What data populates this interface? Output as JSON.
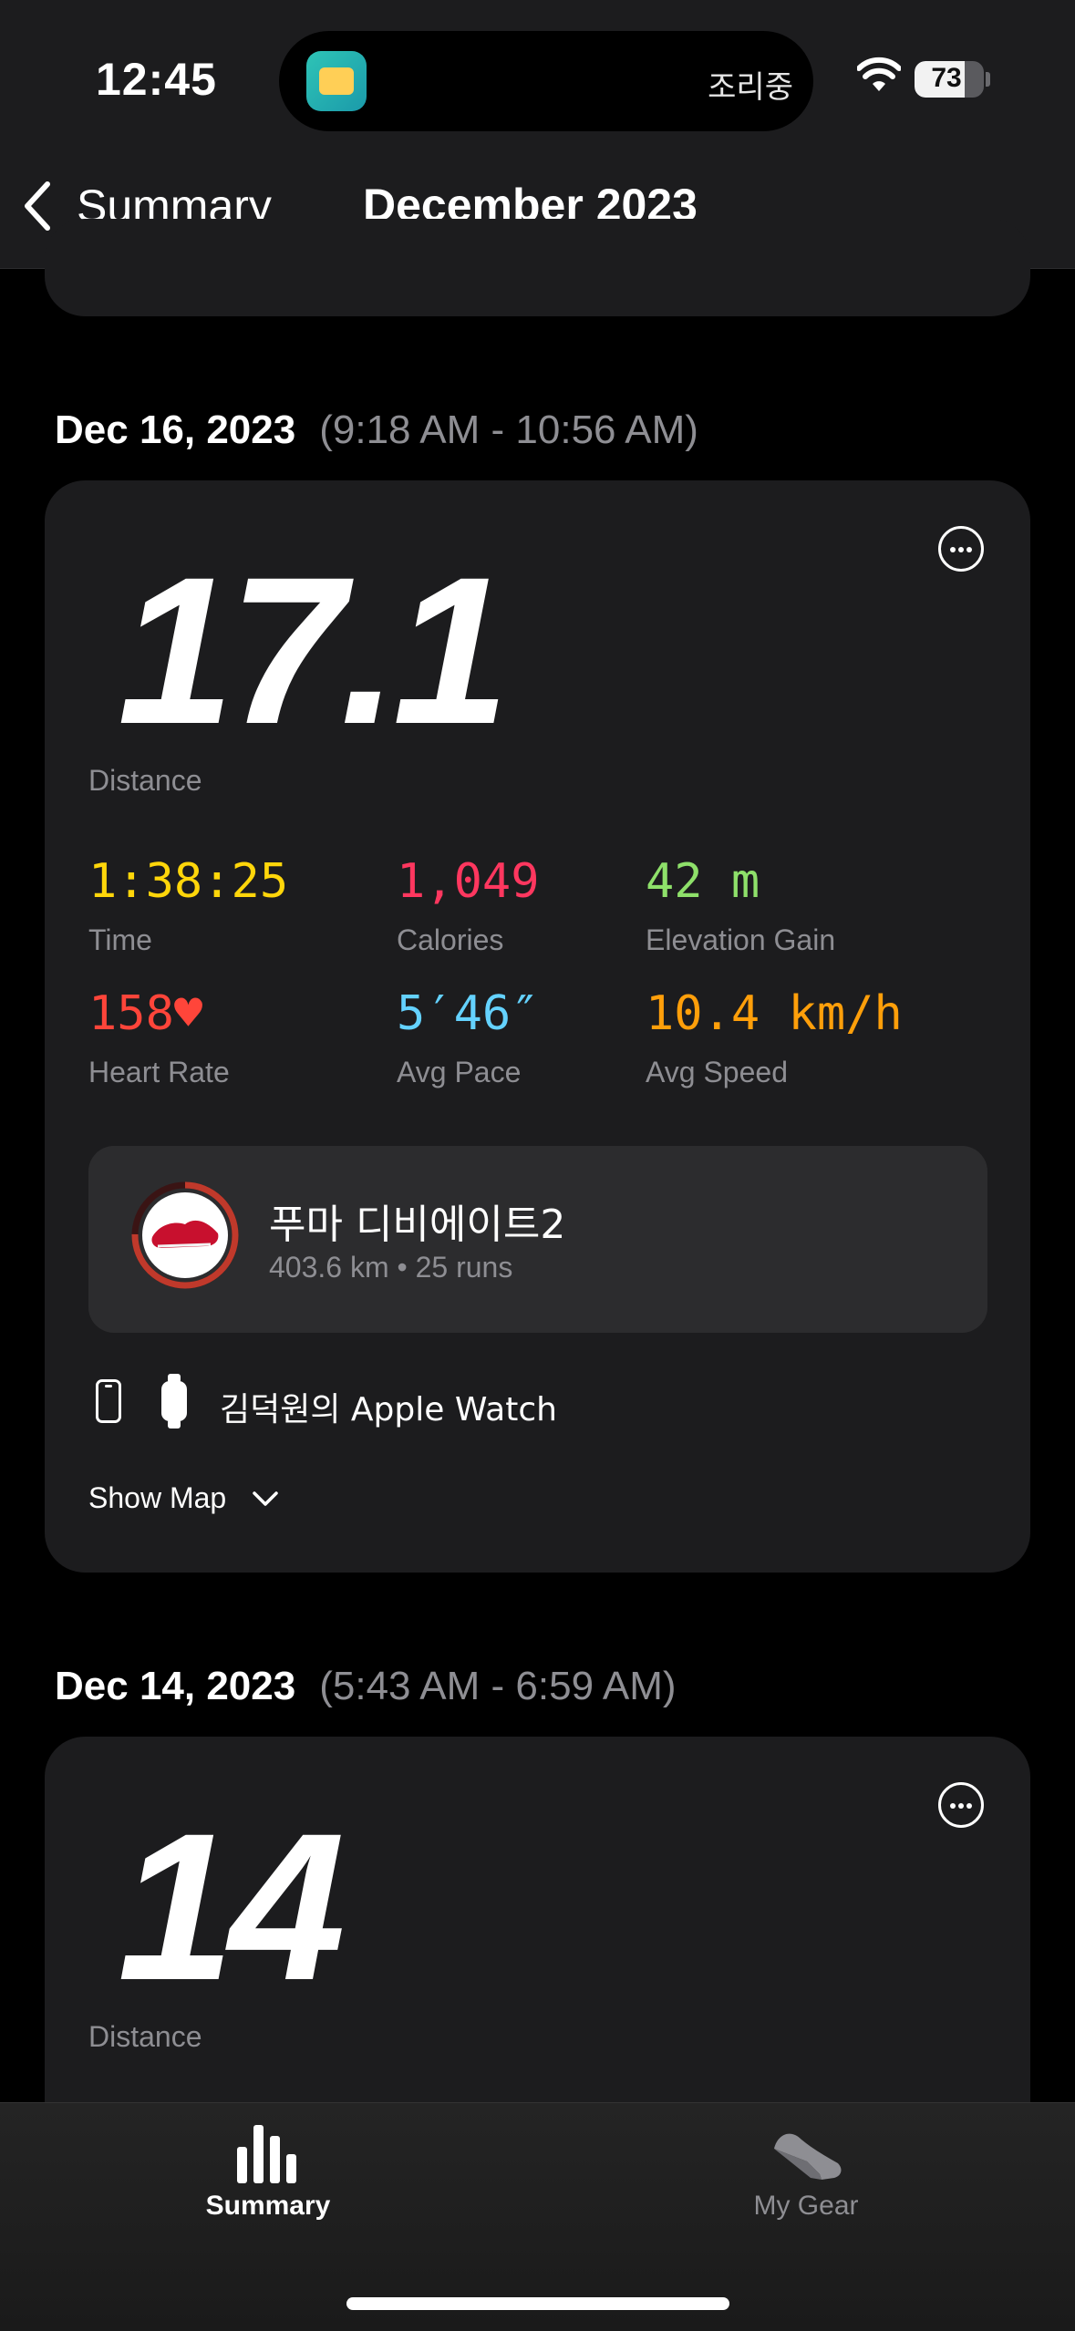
{
  "status_bar": {
    "time": "12:45",
    "island_text": "조리중",
    "battery": "73",
    "battery_level": 0.73
  },
  "nav": {
    "back_label": "Summary",
    "title": "December 2023"
  },
  "workouts": [
    {
      "date": "Dec 16, 2023",
      "time_range": "(9:18 AM - 10:56 AM)",
      "distance": "17.1",
      "distance_label": "Distance",
      "stats": [
        {
          "value": "1:38:25",
          "label": "Time",
          "color": "#ffd60a"
        },
        {
          "value": "1,049",
          "label": "Calories",
          "color": "#ff375f"
        },
        {
          "value": "42 m",
          "label": "Elevation Gain",
          "color": "#8ee06a"
        },
        {
          "value": "158♥",
          "label": "Heart Rate",
          "color": "#ff453a"
        },
        {
          "value": "5′46″",
          "label": "Avg Pace",
          "color": "#64d2ff"
        },
        {
          "value": "10.4 km/h",
          "label": "Avg Speed",
          "color": "#ff9f0a"
        }
      ],
      "gear": {
        "name": "푸마 디비에이트2",
        "detail": "403.6 km • 25 runs"
      },
      "device": "김덕원의 Apple Watch",
      "show_map": "Show Map"
    },
    {
      "date": "Dec 14, 2023",
      "time_range": "(5:43 AM - 6:59 AM)",
      "distance": "14",
      "distance_label": "Distance"
    }
  ],
  "tabs": [
    {
      "label": "Summary",
      "icon": "bar-chart-icon",
      "active": true
    },
    {
      "label": "My Gear",
      "icon": "shoe-icon",
      "active": false
    }
  ]
}
